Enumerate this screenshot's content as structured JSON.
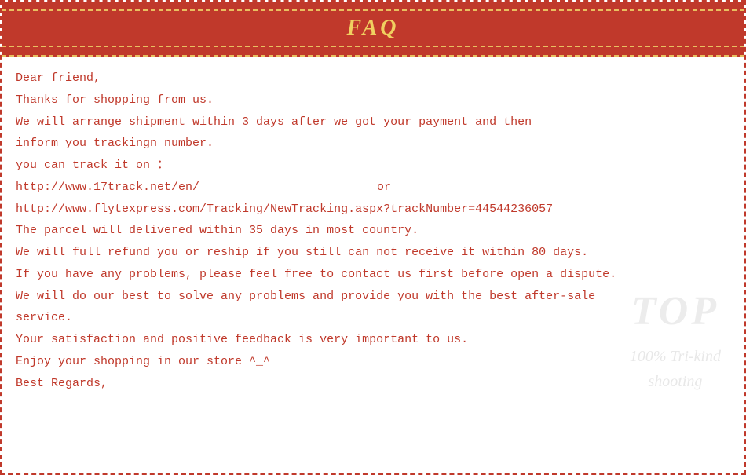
{
  "header": {
    "title": "FAQ"
  },
  "content": {
    "line1": "Dear friend,",
    "line2": "Thanks for shopping from us.",
    "line3": "We will arrange shipment within 3 days after we got your payment and then",
    "line4": "inform you trackingn number.",
    "line5": "you can track it on ：",
    "line6a": "http://www.17track.net/en/",
    "line6b": "or",
    "line7": "http://www.flytexpress.com/Tracking/NewTracking.aspx?trackNumber=44544236057",
    "line8": "The parcel will delivered within 35 days in most country.",
    "line9": "We will full refund you or reship if you still can not receive it within 80 days.",
    "line10": "If you have any problems, please feel free to contact us first before open a dispute.",
    "line11": "We will do our best to solve any problems and provide you with the best after-sale",
    "line12": "service.",
    "line13": "Your satisfaction and positive feedback is very important to us.",
    "line14": "Enjoy your shopping in our store ^_^",
    "line15": "Best Regards,"
  },
  "watermark": {
    "top": "TOP",
    "line1": "100% Tri-kind",
    "line2": "shooting"
  }
}
